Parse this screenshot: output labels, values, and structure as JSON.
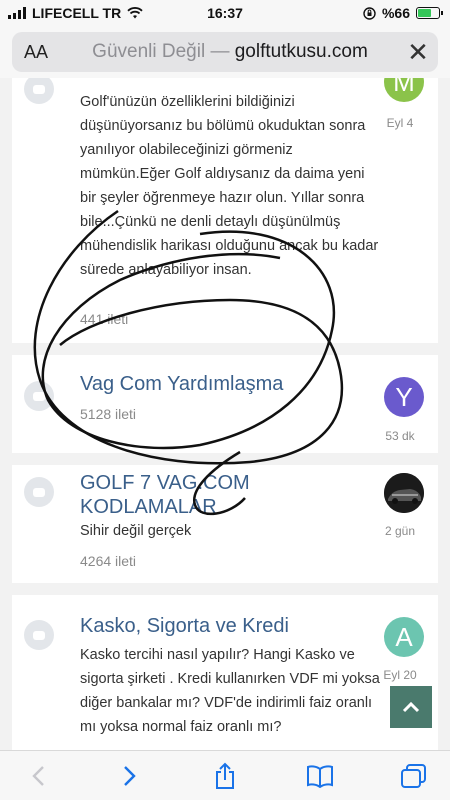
{
  "status": {
    "carrier": "LIFECELL TR",
    "time": "16:37",
    "battery": "%66",
    "battery_level": 0.66
  },
  "address_bar": {
    "text_size_label": "AA",
    "security": "Güvenli Değil",
    "separator": " — ",
    "domain": "golftutkusu.com"
  },
  "forums": [
    {
      "title": "",
      "description": "Golf'ünüzün özelliklerini bildiğinizi düşünüyorsanız bu bölümü okuduktan sonra yanılıyor olabileceğinizi görmeniz mümkün.Eğer Golf aldıysanız da daima yeni bir şeyler öğrenmeye hazır olun. Yıllar sonra bile...Çünkü ne denli detaylı düşünülmüş mühendislik harikası olduğunu ancak bu kadar sürede anlayabiliyor insan.",
      "count": "441 ileti",
      "avatar_letter": "M",
      "avatar_color": "#8bc34a",
      "time": "Eyl 4"
    },
    {
      "title": "Vag Com Yardımlaşma",
      "description": "",
      "count": "5128 ileti",
      "avatar_letter": "Y",
      "avatar_color": "#6a5acd",
      "time": "53 dk"
    },
    {
      "title": "GOLF 7 VAG.COM KODLAMALAR",
      "description": "Sihir değil gerçek",
      "count": "4264 ileti",
      "avatar_letter": "",
      "avatar_color": "#222222",
      "time": "2 gün"
    },
    {
      "title": "Kasko, Sigorta ve Kredi",
      "description": "Kasko tercihi nasıl yapılır? Hangi Kasko ve sigorta şirketi . Kredi kullanırken VDF mi yoksa diğer bankalar mı? VDF'de indirimli faiz oranlı mı yoksa normal faiz oranlı mı?",
      "count": "",
      "avatar_letter": "A",
      "avatar_color": "#6cc5b0",
      "time": "Eyl 20"
    }
  ],
  "colors": {
    "link": "#3a5f8a",
    "toolbar_icon": "#1a73e8",
    "scroll_top_bg": "#4a7a6d"
  },
  "toolbar": {
    "icons": [
      "back-icon",
      "forward-icon",
      "share-icon",
      "bookmarks-icon",
      "tabs-icon"
    ]
  }
}
